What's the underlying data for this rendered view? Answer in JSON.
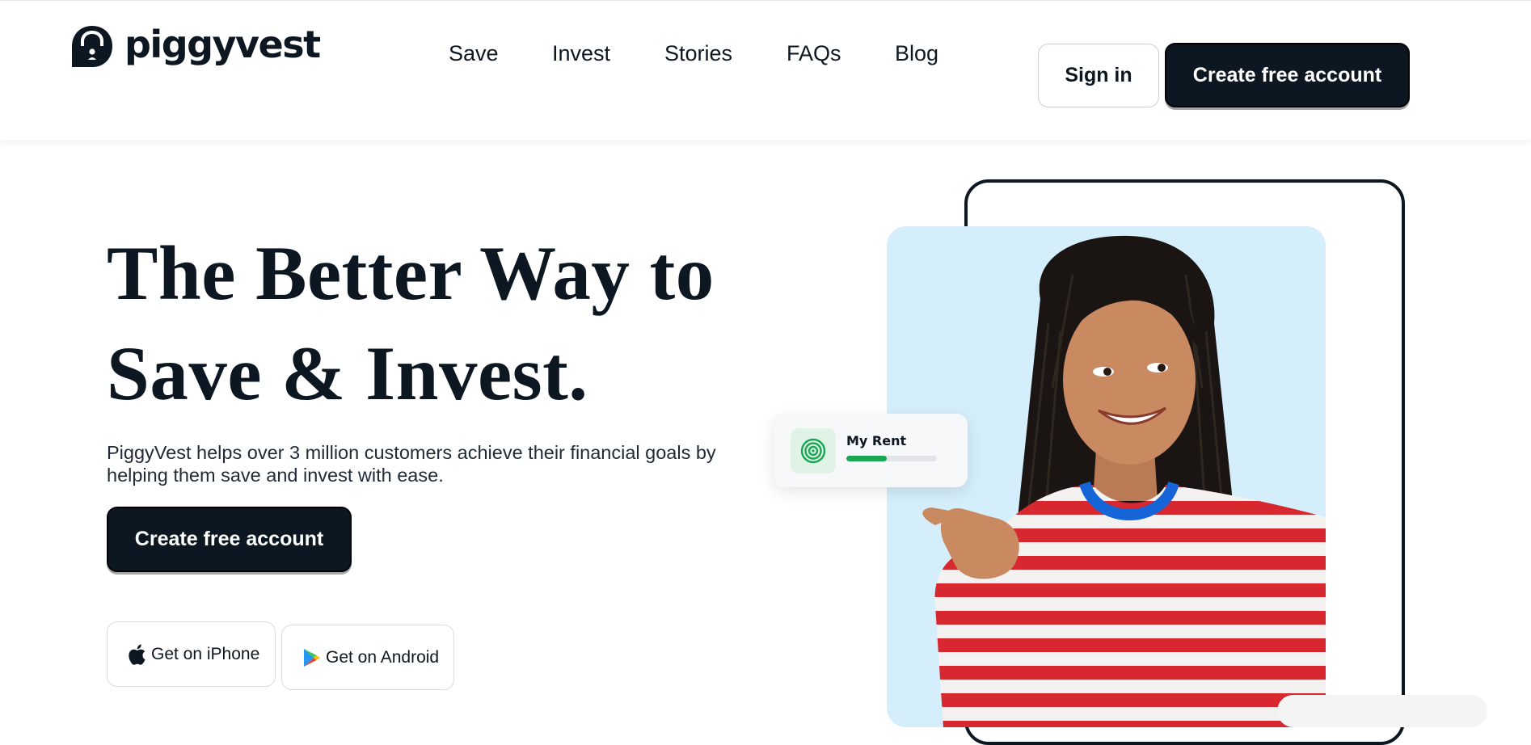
{
  "brand": {
    "name": "piggyvest",
    "logo_icon": "piggyvest-lock-icon",
    "primary_dark": "#0d1722"
  },
  "nav": {
    "items": [
      {
        "label": "Save"
      },
      {
        "label": "Invest"
      },
      {
        "label": "Stories"
      },
      {
        "label": "FAQs"
      },
      {
        "label": "Blog"
      }
    ]
  },
  "header": {
    "signin_label": "Sign in",
    "cta_label": "Create free account"
  },
  "hero": {
    "title": "The Better Way to Save & Invest.",
    "subtitle": "PiggyVest helps over 3 million customers achieve their financial goals by helping them save and invest with ease.",
    "cta_label": "Create free account",
    "store_buttons": [
      {
        "label": "Get on iPhone",
        "icon": "apple-icon"
      },
      {
        "label": "Get on Android",
        "icon": "google-play-icon"
      }
    ]
  },
  "savings_card": {
    "label": "My Rent",
    "icon": "target-icon",
    "progress_fraction": 0.45,
    "progress_color": "#1aa653"
  },
  "visual": {
    "photo_background": "#d4eefb",
    "photo_subject": "smiling-woman-photo"
  }
}
